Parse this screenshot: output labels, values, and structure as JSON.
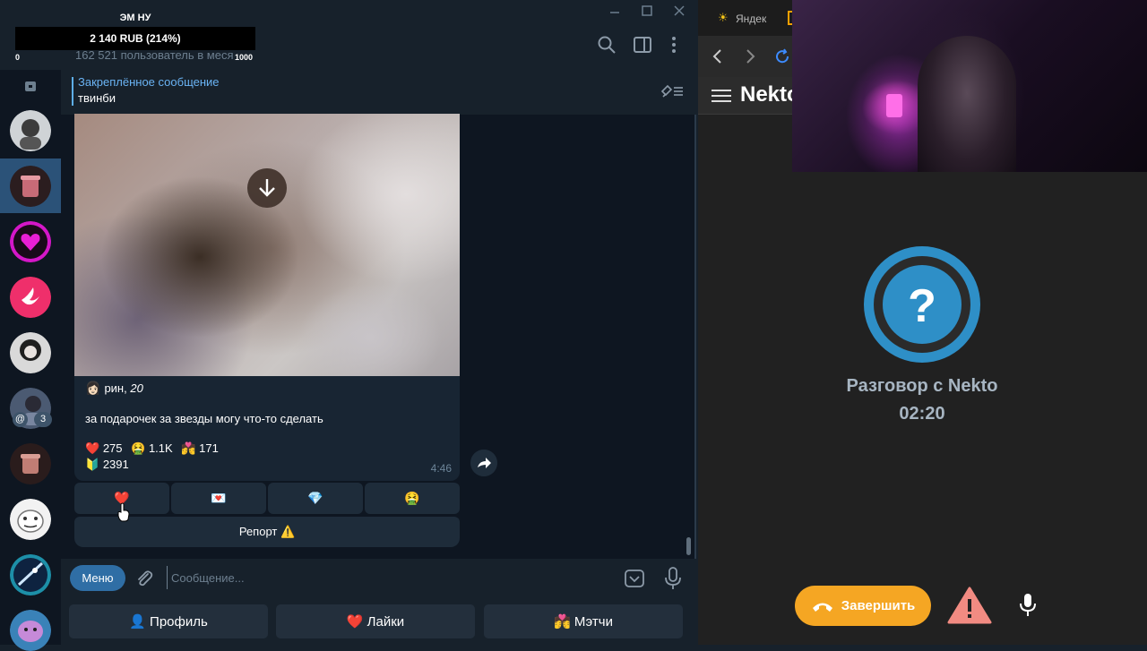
{
  "stream": {
    "title": "ЭМ НУ",
    "donation_goal": "2 140 RUB (214%)",
    "goal_min": "0",
    "goal_max": "1000"
  },
  "chat_header": {
    "subscribers": "162 521 пользователь в меся"
  },
  "pinned": {
    "title": "Закреплённое сообщение",
    "text": "твинби"
  },
  "sidebar": {
    "mention_badge": "@",
    "unread_badge": "3"
  },
  "message": {
    "author_emoji": "👩🏻",
    "author_name": "рин, ",
    "author_age": "20",
    "text": "за подарочек за звезды могу что-то сделать",
    "reactions": [
      {
        "emoji": "❤️",
        "count": "275"
      },
      {
        "emoji": "🤮",
        "count": "1.1K"
      },
      {
        "emoji": "💏",
        "count": "171"
      }
    ],
    "reaction_extra": {
      "emoji": "🔰",
      "count": "2391"
    },
    "time": "4:46"
  },
  "inline_keyboard": {
    "buttons": [
      "❤️",
      "💌",
      "💎",
      "🤮"
    ],
    "report": "Репорт ⚠️"
  },
  "input": {
    "menu_label": "Меню",
    "placeholder": "Сообщение..."
  },
  "reply_keyboard": {
    "profile": "👤 Профиль",
    "likes": "❤️ Лайки",
    "matches": "💏 Мэтчи"
  },
  "browser": {
    "tab_label": "Яндек",
    "site_logo": "Nekto",
    "call_title": "Разговор с Nekto",
    "call_timer": "02:20",
    "end_label": "Завершить"
  },
  "colors": {
    "accent_blue": "#2f6ea5",
    "end_call": "#f5a623",
    "warning": "#f28b82",
    "avatar_ring": "#2e8fc7"
  }
}
